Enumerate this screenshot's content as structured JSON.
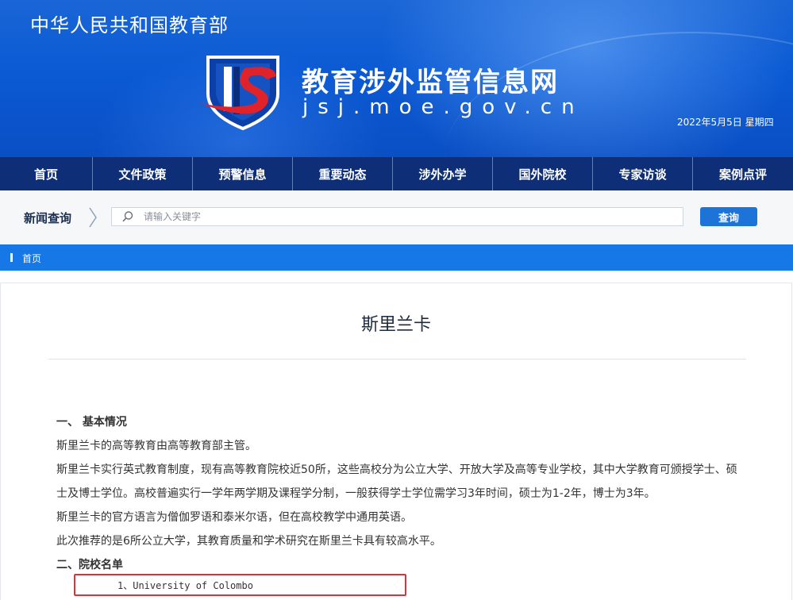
{
  "header": {
    "ministry": "中华人民共和国教育部",
    "site_name": "教育涉外监管信息网",
    "site_domain": "jsj.moe.gov.cn",
    "date": "2022年5月5日  星期四",
    "logo_icon": "jsj-shield-logo-icon"
  },
  "nav": {
    "items": [
      {
        "label": "首页"
      },
      {
        "label": "文件政策"
      },
      {
        "label": "预警信息"
      },
      {
        "label": "重要动态"
      },
      {
        "label": "涉外办学"
      },
      {
        "label": "国外院校"
      },
      {
        "label": "专家访谈"
      },
      {
        "label": "案例点评"
      }
    ]
  },
  "search": {
    "label": "新闻查询",
    "placeholder": "请输入关键字",
    "value": "",
    "button": "查询"
  },
  "breadcrumb": {
    "home": "首页"
  },
  "article": {
    "title": "斯里兰卡",
    "section1_heading": "一、  基本情况",
    "p1": "斯里兰卡的高等教育由高等教育部主管。",
    "p2": "斯里兰卡实行英式教育制度，现有高等教育院校近50所，这些高校分为公立大学、开放大学及高等专业学校，其中大学教育可颁授学士、硕士及博士学位。高校普遍实行一学年两学期及课程学分制，一般获得学士学位需学习3年时间，硕士为1-2年，博士为3年。",
    "p3": "斯里兰卡的官方语言为僧伽罗语和泰米尔语，但在高校教学中通用英语。",
    "p4": "此次推荐的是6所公立大学，其教育质量和学术研究在斯里兰卡具有较高水平。",
    "section2_heading": "二、院校名单",
    "university_1": "1、University of Colombo"
  },
  "colors": {
    "banner_blue": "#0b5ad4",
    "nav_navy": "#0e2f77",
    "crumb_blue": "#1677e6",
    "button_blue": "#1d74d8",
    "highlight_red": "#e0313a"
  }
}
